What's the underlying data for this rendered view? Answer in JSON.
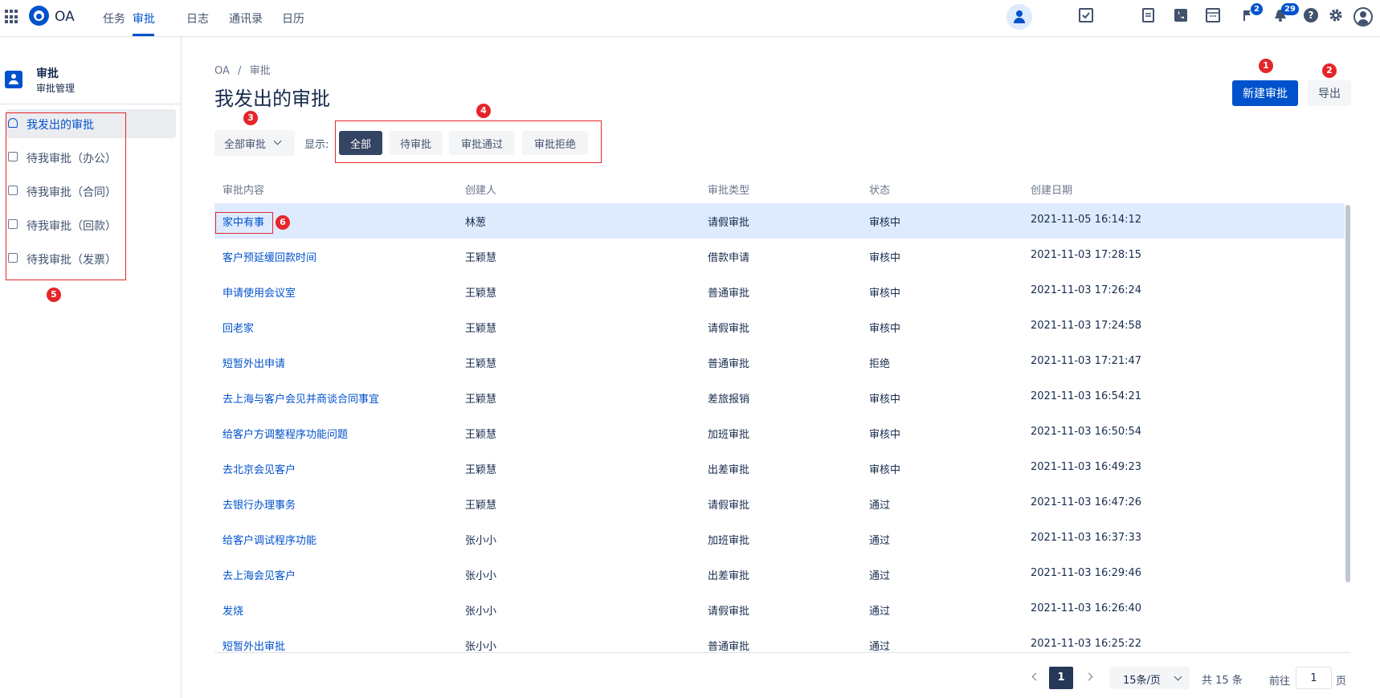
{
  "topbar": {
    "brand": "OA",
    "nav": [
      "任务",
      "审批",
      "日志",
      "通讯录",
      "日历"
    ],
    "flag_badge": "2",
    "bell_badge": "29",
    "help_glyph": "?",
    "icons": [
      "apps-grid-icon",
      "oa-logo-icon",
      "task-check-icon",
      "user-icon",
      "document-icon",
      "phone-icon",
      "calendar-icon",
      "flag-icon",
      "bell-icon",
      "help-icon",
      "settings-icon",
      "user-avatar-icon"
    ]
  },
  "sidebar": {
    "title": "审批",
    "subtitle": "审批管理",
    "items": [
      "我发出的审批",
      "待我审批（办公）",
      "待我审批（合同）",
      "待我审批（回款）",
      "待我审批（发票）"
    ]
  },
  "main": {
    "breadcrumb": [
      "OA",
      "/",
      "审批"
    ],
    "title": "我发出的审批",
    "new_button": "新建审批",
    "export_button": "导出",
    "filter_dropdown": "全部审批",
    "show_label": "显示:",
    "segments": [
      "全部",
      "待审批",
      "审批通过",
      "审批拒绝"
    ],
    "active_segment": "全部"
  },
  "table": {
    "columns": [
      "审批内容",
      "创建人",
      "审批类型",
      "状态",
      "创建日期"
    ],
    "rows": [
      [
        "家中有事",
        "林葱",
        "请假审批",
        "审核中",
        "2021-11-05 16:14:12"
      ],
      [
        "客户预延缓回款时间",
        "王颖慧",
        "借款申请",
        "审核中",
        "2021-11-03 17:28:15"
      ],
      [
        "申请使用会议室",
        "王颖慧",
        "普通审批",
        "审核中",
        "2021-11-03 17:26:24"
      ],
      [
        "回老家",
        "王颖慧",
        "请假审批",
        "审核中",
        "2021-11-03 17:24:58"
      ],
      [
        "短暂外出申请",
        "王颖慧",
        "普通审批",
        "拒绝",
        "2021-11-03 17:21:47"
      ],
      [
        "去上海与客户会见并商谈合同事宜",
        "王颖慧",
        "差旅报销",
        "审核中",
        "2021-11-03 16:54:21"
      ],
      [
        "给客户方调整程序功能问题",
        "王颖慧",
        "加班审批",
        "审核中",
        "2021-11-03 16:50:54"
      ],
      [
        "去北京会见客户",
        "王颖慧",
        "出差审批",
        "审核中",
        "2021-11-03 16:49:23"
      ],
      [
        "去银行办理事务",
        "王颖慧",
        "请假审批",
        "通过",
        "2021-11-03 16:47:26"
      ],
      [
        "给客户调试程序功能",
        "张小小",
        "加班审批",
        "通过",
        "2021-11-03 16:37:33"
      ],
      [
        "去上海会见客户",
        "张小小",
        "出差审批",
        "通过",
        "2021-11-03 16:29:46"
      ],
      [
        "发烧",
        "张小小",
        "请假审批",
        "通过",
        "2021-11-03 16:26:40"
      ],
      [
        "短暂外出审批",
        "张小小",
        "普通审批",
        "通过",
        "2021-11-03 16:25:22"
      ]
    ]
  },
  "pagination": {
    "current": "1",
    "page_size": "15条/页",
    "total": "共 15 条",
    "goto_label": "前往",
    "goto_value": "1",
    "page_suffix": "页"
  },
  "annotations": [
    "1",
    "2",
    "3",
    "4",
    "5",
    "6"
  ],
  "colors": {
    "accent": "#0052cc",
    "annotation": "#e5252a",
    "row_highlight": "#deebff",
    "active_segment": "#344563"
  }
}
